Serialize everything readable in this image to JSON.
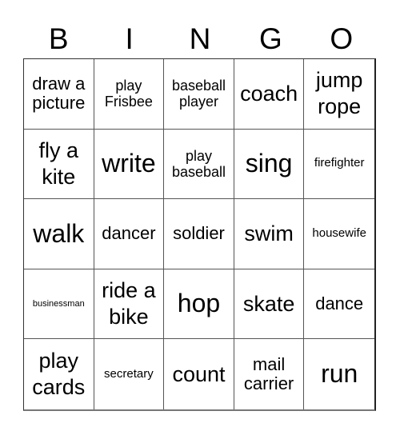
{
  "header": {
    "letters": [
      "B",
      "I",
      "N",
      "G",
      "O"
    ]
  },
  "card": {
    "rows": [
      [
        {
          "text": "draw a picture",
          "size": "lg"
        },
        {
          "text": "play Frisbee",
          "size": "md"
        },
        {
          "text": "baseball player",
          "size": "md"
        },
        {
          "text": "coach",
          "size": "xl"
        },
        {
          "text": "jump rope",
          "size": "xl"
        }
      ],
      [
        {
          "text": "fly a kite",
          "size": "xl"
        },
        {
          "text": "write",
          "size": "xxl"
        },
        {
          "text": "play baseball",
          "size": "md"
        },
        {
          "text": "sing",
          "size": "xxl"
        },
        {
          "text": "firefighter",
          "size": "sm"
        }
      ],
      [
        {
          "text": "walk",
          "size": "xxl"
        },
        {
          "text": "dancer",
          "size": "lg"
        },
        {
          "text": "soldier",
          "size": "lg"
        },
        {
          "text": "swim",
          "size": "xl"
        },
        {
          "text": "housewife",
          "size": "sm"
        }
      ],
      [
        {
          "text": "businessman",
          "size": "xs"
        },
        {
          "text": "ride a bike",
          "size": "xl"
        },
        {
          "text": "hop",
          "size": "xxl"
        },
        {
          "text": "skate",
          "size": "xl"
        },
        {
          "text": "dance",
          "size": "lg"
        }
      ],
      [
        {
          "text": "play cards",
          "size": "xl"
        },
        {
          "text": "secretary",
          "size": "sm"
        },
        {
          "text": "count",
          "size": "xl"
        },
        {
          "text": "mail carrier",
          "size": "lg"
        },
        {
          "text": "run",
          "size": "xxl"
        }
      ]
    ]
  }
}
